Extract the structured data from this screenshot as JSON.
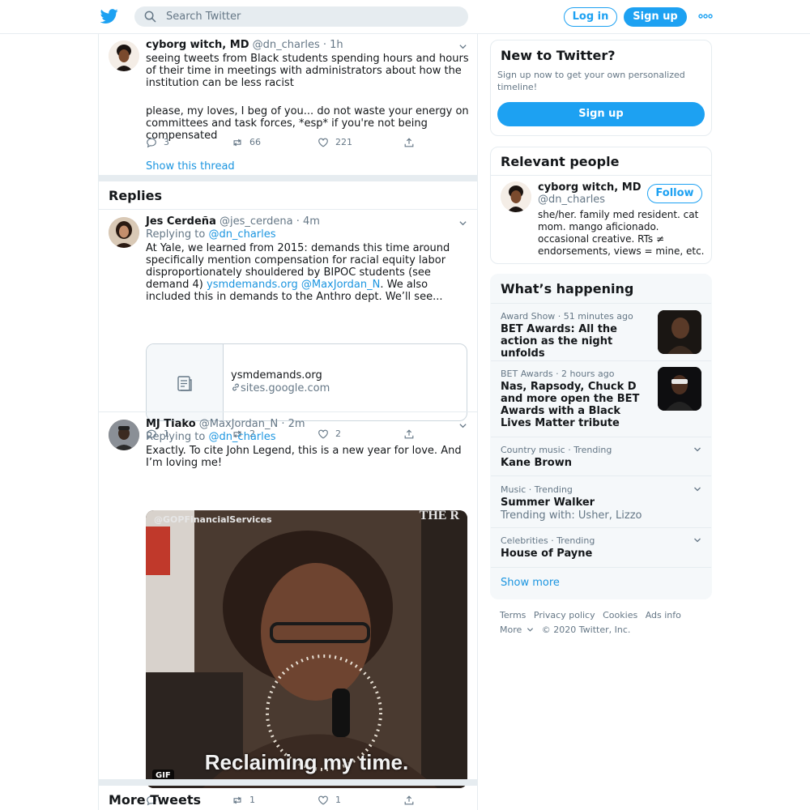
{
  "header": {
    "search_placeholder": "Search Twitter",
    "login_label": "Log in",
    "signup_label": "Sign up",
    "brand_color": "#1da1f2",
    "logo_icon": "twitter-bird-icon",
    "more_icon": "more-dots-icon"
  },
  "main_tweet": {
    "name": "cyborg witch, MD",
    "handle": "@dn_charles",
    "time": "· 1h",
    "text1": "seeing tweets from Black students spending hours and hours of their time in meetings with administrators about how the institution can be less racist",
    "text2": "please, my loves, I beg of you... do not waste your energy on committees and task forces, *esp* if you're not being compensated",
    "replies": "3",
    "retweets": "66",
    "likes": "221",
    "show_thread": "Show this thread"
  },
  "replies_title": "Replies",
  "reply1": {
    "name": "Jes Cerdeña",
    "handle": "@jes_cerdena",
    "time": "· 4m",
    "replying_prefix": "Replying to",
    "replying_to": "@dn_charles",
    "text": "At Yale, we learned from 2015: demands this time around specifically mention compensation for racial equity labor disproportionately shouldered by BIPOC students (see demand 4)",
    "link1": "ysmdemands.org",
    "link2": "@MaxJordan_N",
    "text_after": ". We also included this in demands to the Anthro dept. We’ll see...",
    "card_title": "ysmdemands.org",
    "card_domain": "sites.google.com",
    "replies": "1",
    "retweets": "2",
    "likes": "2"
  },
  "reply2": {
    "name": "MJ Tiako",
    "handle": "@MaxJordan_N",
    "time": "· 2m",
    "replying_prefix": "Replying to",
    "replying_to": "@dn_charles",
    "text": "Exactly. To cite John Legend, this is a new year for love. And I’m loving me!",
    "gif_watermark": "@GOPFinancialServices",
    "gif_watermark_right": "THE R",
    "gif_caption": "Reclaiming my time.",
    "gif_badge": "GIF",
    "replies": "",
    "retweets": "1",
    "likes": "1"
  },
  "more_tweets_title": "More Tweets",
  "new_to_twitter": {
    "title": "New to Twitter?",
    "desc": "Sign up now to get your own personalized timeline!",
    "button": "Sign up"
  },
  "relevant_people": {
    "title": "Relevant people",
    "name": "cyborg witch, MD",
    "handle": "@dn_charles",
    "follow": "Follow",
    "bio": "she/her. family med resident. cat mom. mango aficionado. occasional creative. RTs ≠ endorsements, views = mine, etc."
  },
  "whats_happening": {
    "title": "What’s happening",
    "trends": [
      {
        "meta": "Award Show · 51 minutes ago",
        "title": "BET Awards: All the action as the night unfolds",
        "sub": ""
      },
      {
        "meta": "BET Awards · 2 hours ago",
        "title": "Nas, Rapsody, Chuck D and more open the BET Awards with a Black Lives Matter tribute",
        "sub": ""
      },
      {
        "meta": "Country music · Trending",
        "title": "Kane Brown",
        "sub": ""
      },
      {
        "meta": "Music · Trending",
        "title": "Summer Walker",
        "sub": "Trending with: Usher, Lizzo"
      },
      {
        "meta": "Celebrities · Trending",
        "title": "House of Payne",
        "sub": ""
      }
    ],
    "show_more": "Show more"
  },
  "footer": {
    "terms": "Terms",
    "privacy": "Privacy policy",
    "cookies": "Cookies",
    "ads": "Ads info",
    "more": "More",
    "copyright": "© 2020 Twitter, Inc."
  }
}
